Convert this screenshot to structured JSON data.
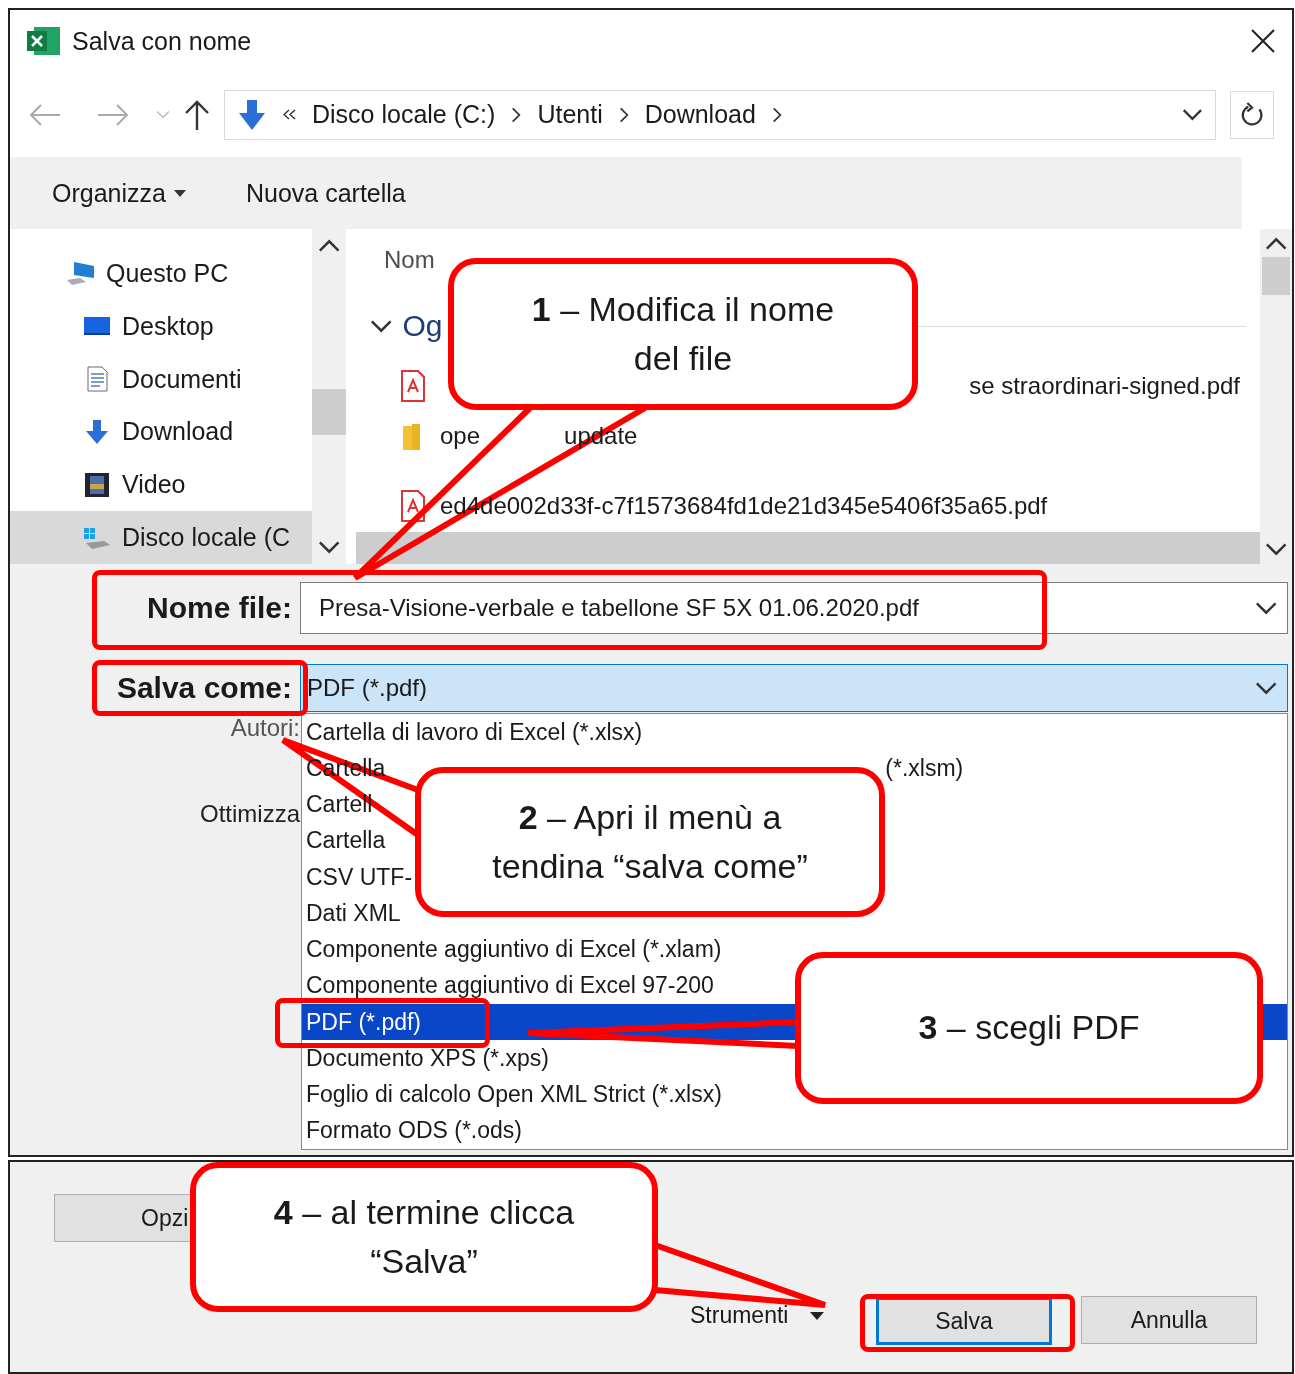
{
  "window": {
    "title": "Salva con nome"
  },
  "nav": {
    "path": [
      "Disco locale (C:)",
      "Utenti",
      "Download"
    ]
  },
  "toolbar": {
    "organize": "Organizza",
    "new_folder": "Nuova cartella"
  },
  "sidebar": {
    "items": [
      {
        "label": "Questo PC",
        "kind": "pc",
        "selected": false
      },
      {
        "label": "Desktop",
        "kind": "desktop",
        "selected": false
      },
      {
        "label": "Documenti",
        "kind": "documents",
        "selected": false
      },
      {
        "label": "Download",
        "kind": "download",
        "selected": false
      },
      {
        "label": "Video",
        "kind": "video",
        "selected": false
      },
      {
        "label": "Disco locale (C",
        "kind": "drive",
        "selected": true
      }
    ]
  },
  "files": {
    "column": "Nom",
    "group": "Og",
    "rows": [
      {
        "kind": "pdf",
        "name_end": "se straordinari-signed.pdf"
      },
      {
        "kind": "folder",
        "name_start": "ope",
        "name_end": "update"
      },
      {
        "kind": "pdf",
        "name_start": "ed4de002d33f-c7f1573684fd1de21d345e5406f35a65.pdf"
      }
    ]
  },
  "form": {
    "filename_label": "Nome file:",
    "filename": "Presa-Visione-verbale e tabellone SF 5X 01.06.2020.pdf",
    "type_label": "Salva come:",
    "type_value": "PDF (*.pdf)",
    "authors_label": "Autori:",
    "optimize_label": "Ottimizza"
  },
  "type_menu": {
    "items": [
      {
        "text": "Cartella di lavoro di Excel (*.xlsx)",
        "selected": false
      },
      {
        "text": "Cartella",
        "tail": "(*.xlsm)",
        "selected": false
      },
      {
        "text": "Cartell",
        "selected": false
      },
      {
        "text": "Cartella",
        "selected": false
      },
      {
        "text": "CSV UTF-",
        "selected": false
      },
      {
        "text": "Dati XML",
        "selected": false
      },
      {
        "text": "Componente aggiuntivo di Excel (*.xlam)",
        "selected": false
      },
      {
        "text": "Componente aggiuntivo di Excel 97-200",
        "selected": false
      },
      {
        "text": "PDF (*.pdf)",
        "selected": true
      },
      {
        "text": "Documento XPS (*.xps)",
        "selected": false
      },
      {
        "text": "Foglio di calcolo Open XML Strict (*.xlsx)",
        "selected": false
      },
      {
        "text": "Formato ODS (*.ods)",
        "selected": false
      }
    ]
  },
  "footer": {
    "options": "Opzi",
    "tools": "Strumenti",
    "save": "Salva",
    "cancel": "Annulla"
  },
  "callouts": [
    {
      "text": "**1** – Modifica il nome del file"
    },
    {
      "text": "**2** – Apri il menù a tendina “salva come”"
    },
    {
      "text": "**3** – scegli PDF"
    },
    {
      "text": "**4** – al termine clicca “Salva”"
    }
  ]
}
